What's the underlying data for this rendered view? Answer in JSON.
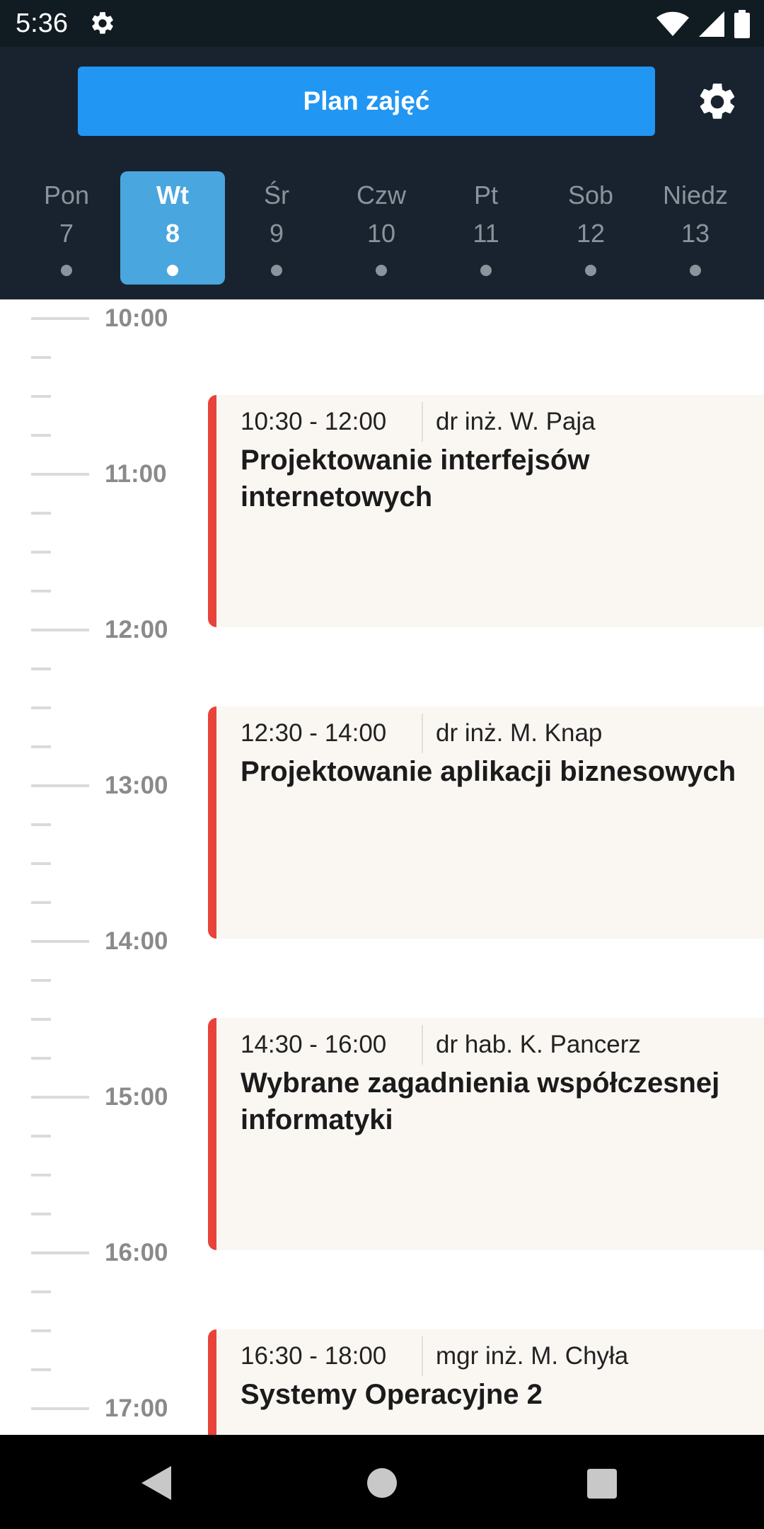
{
  "status": {
    "time": "5:36",
    "icons": [
      "gear-icon",
      "wifi-icon",
      "cell-signal-icon",
      "battery-icon"
    ]
  },
  "header": {
    "title": "Plan zajęć",
    "settings_icon": "gear-icon"
  },
  "days": [
    {
      "name": "Pon",
      "num": "7",
      "selected": false
    },
    {
      "name": "Wt",
      "num": "8",
      "selected": true
    },
    {
      "name": "Śr",
      "num": "9",
      "selected": false
    },
    {
      "name": "Czw",
      "num": "10",
      "selected": false
    },
    {
      "name": "Pt",
      "num": "11",
      "selected": false
    },
    {
      "name": "Sob",
      "num": "12",
      "selected": false
    },
    {
      "name": "Niedz",
      "num": "13",
      "selected": false
    }
  ],
  "timeline": {
    "hours": [
      "10:00",
      "11:00",
      "12:00",
      "13:00",
      "14:00",
      "15:00",
      "16:00",
      "17:00"
    ]
  },
  "events": [
    {
      "time": "10:30 - 12:00",
      "teacher": "dr inż. W. Paja",
      "title": "Projektowanie interfejsów internetowych"
    },
    {
      "time": "12:30 - 14:00",
      "teacher": "dr inż. M. Knap",
      "title": "Projektowanie aplikacji biznesowych"
    },
    {
      "time": "14:30 - 16:00",
      "teacher": "dr hab. K. Pancerz",
      "title": "Wybrane zagadnienia współczesnej informatyki"
    },
    {
      "time": "16:30 - 18:00",
      "teacher": "mgr inż. M. Chyła",
      "title": "Systemy Operacyjne 2"
    }
  ],
  "colors": {
    "header_bg": "#18232f",
    "accent": "#2196f3",
    "selected_day": "#4aa6de",
    "event_bar": "#e8433a",
    "event_bg": "#faf7f3"
  },
  "navbar": {
    "icons": [
      "back-icon",
      "home-icon",
      "recents-icon"
    ]
  }
}
